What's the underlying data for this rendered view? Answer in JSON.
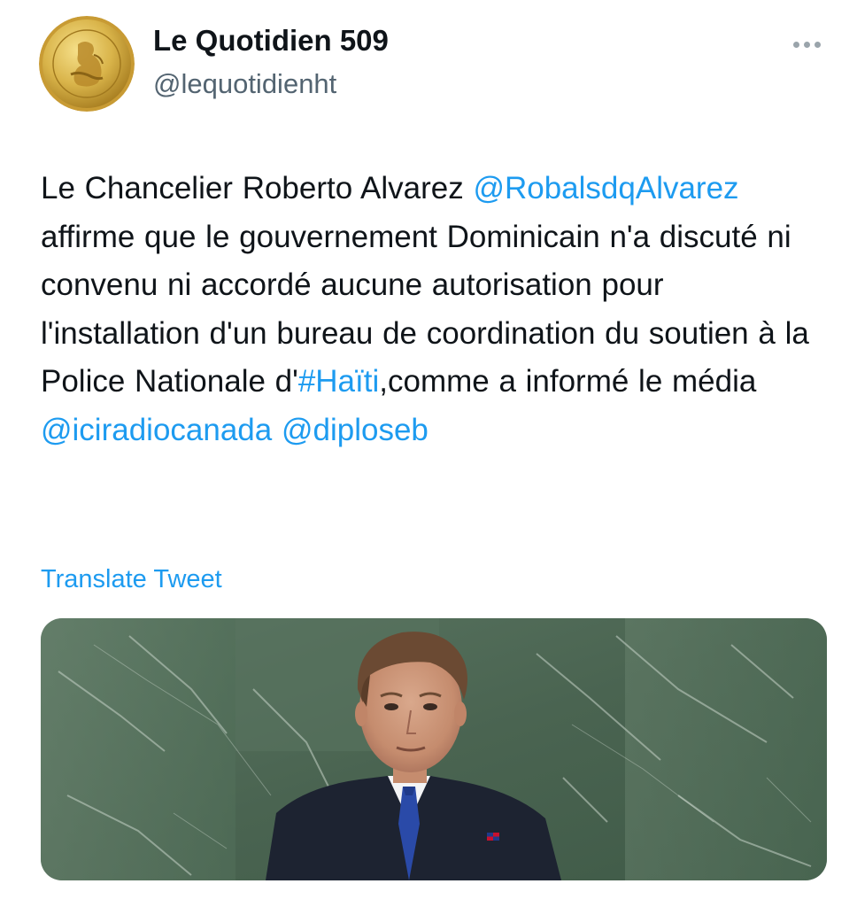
{
  "account": {
    "display_name": "Le Quotidien 509",
    "handle": "@lequotidienht",
    "avatar_icon": "gold-coin-seal-icon",
    "avatar_lettering": [
      "REPUBLIQUE D'HAITI",
      "MACKANDAL"
    ]
  },
  "tweet": {
    "text_segments": [
      {
        "text": "Le Chancelier Roberto Alvarez ",
        "type": "text"
      },
      {
        "text": "@RobalsdqAlvarez",
        "type": "mention"
      },
      {
        "text": " affirme que le gouvernement Dominicain n'a discuté ni convenu ni accordé aucune autorisation pour l'installation d'un bureau de coordination du soutien à la Police Nationale d'",
        "type": "text"
      },
      {
        "text": "#Haïti",
        "type": "hashtag"
      },
      {
        "text": ",comme a informé le média ",
        "type": "text"
      },
      {
        "text": "@iciradiocanada",
        "type": "mention"
      },
      {
        "text": " ",
        "type": "text"
      },
      {
        "text": "@diploseb",
        "type": "mention"
      }
    ],
    "translate_label": "Translate Tweet",
    "more_icon": "more-options-icon"
  },
  "media": {
    "description_icon": "speaker-at-podium-photo",
    "background_color": "#4f6b56",
    "flag_pin_icon": "dominican-flag-pin-icon"
  },
  "colors": {
    "link": "#1d9bf0",
    "text": "#0f1419",
    "secondary": "#536471",
    "background": "#ffffff"
  }
}
